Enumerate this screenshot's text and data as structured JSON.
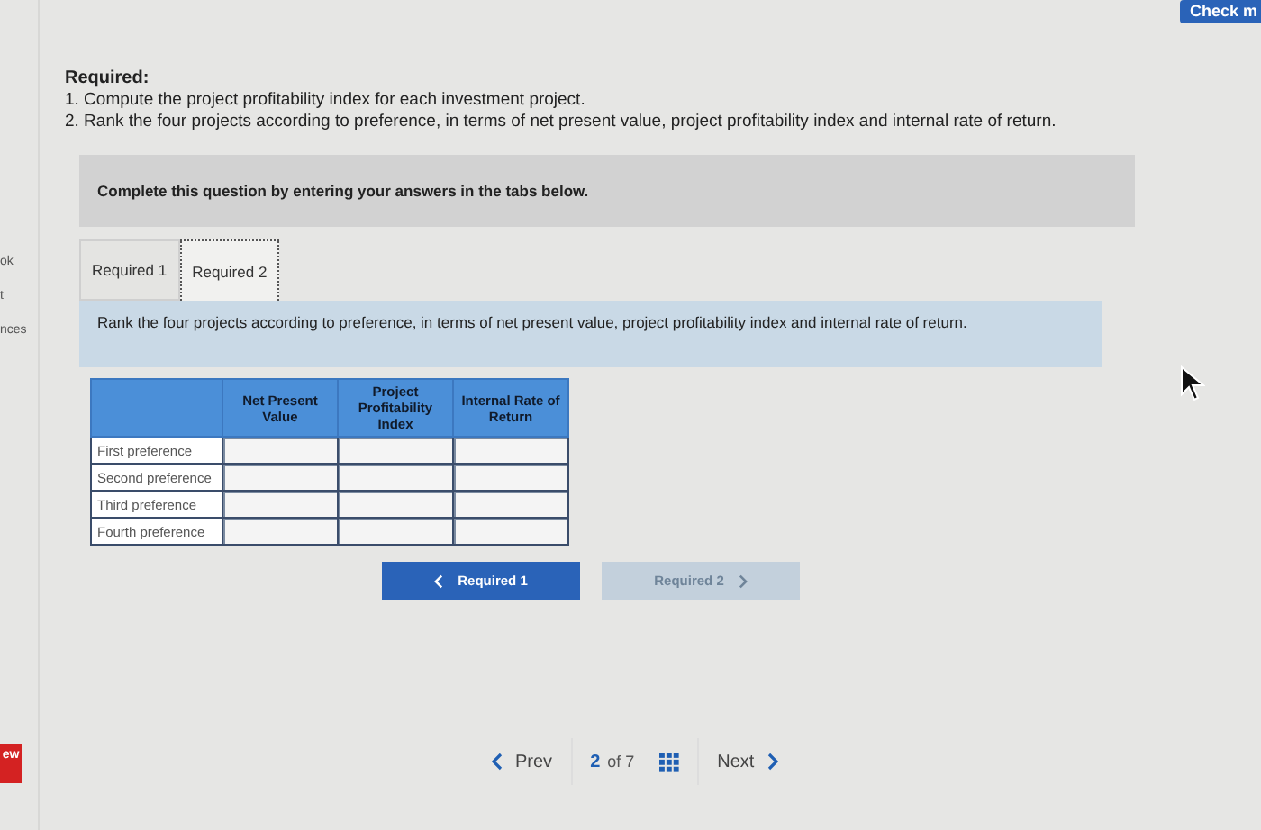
{
  "check_button": {
    "label": "Check m"
  },
  "sidebar": {
    "items": [
      "ok",
      "t",
      "nces"
    ],
    "badge": "ew"
  },
  "required": {
    "heading": "Required:",
    "items": [
      "1. Compute the project profitability index for each investment project.",
      "2. Rank the four projects according to preference, in terms of net present value, project profitability index and internal rate of return."
    ]
  },
  "instruction": "Complete this question by entering your answers in the tabs below.",
  "tabs": [
    {
      "label": "Required 1",
      "selected": false
    },
    {
      "label": "Required 2",
      "selected": true
    }
  ],
  "prompt": "Rank the four projects according to preference, in terms of net present value, project profitability index and internal rate of return.",
  "table": {
    "columns": [
      "Net Present Value",
      "Project Profitability Index",
      "Internal Rate of Return"
    ],
    "rows": [
      {
        "label": "First preference"
      },
      {
        "label": "Second preference"
      },
      {
        "label": "Third preference"
      },
      {
        "label": "Fourth preference"
      }
    ]
  },
  "nav_buttons": [
    {
      "label": "Required 1",
      "kind": "back",
      "disabled": false
    },
    {
      "label": "Required 2",
      "kind": "forward",
      "disabled": true
    }
  ],
  "pager": {
    "prev": "Prev",
    "current": "2",
    "of": "of 7",
    "next": "Next"
  }
}
